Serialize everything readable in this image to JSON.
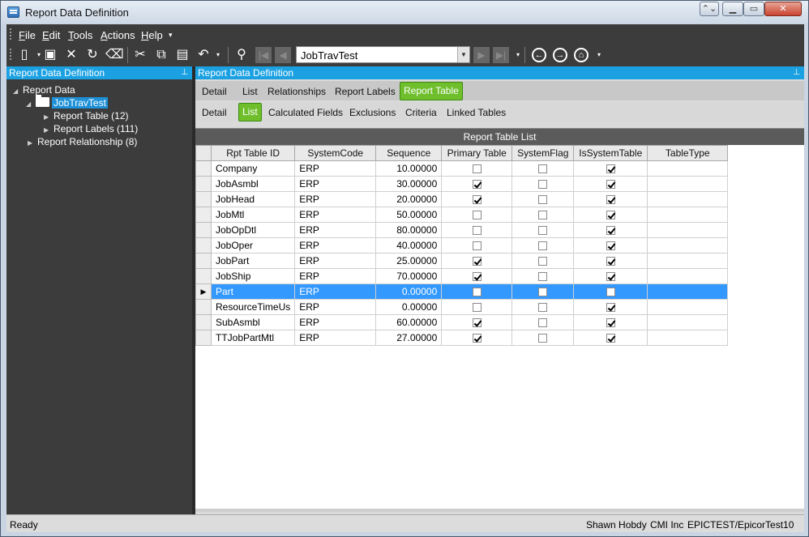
{
  "window": {
    "title": "Report Data Definition"
  },
  "menu": {
    "file": "File",
    "edit": "Edit",
    "tools": "Tools",
    "actions": "Actions",
    "help": "Help"
  },
  "toolbar": {
    "combo_value": "JobTravTest"
  },
  "left_panel": {
    "header": "Report Data Definition",
    "tree": {
      "root": "Report Data",
      "node": "JobTravTest",
      "child1": "Report Table (12)",
      "child2": "Report Labels (111)",
      "sibling": "Report Relationship (8)"
    }
  },
  "right_panel": {
    "header": "Report Data Definition",
    "tabs_top": [
      "Detail",
      "List",
      "Relationships",
      "Report Labels",
      "Report Table"
    ],
    "tabs_top_active": "Report Table",
    "tabs_sub": [
      "Detail",
      "List",
      "Calculated Fields",
      "Exclusions",
      "Criteria",
      "Linked Tables"
    ],
    "tabs_sub_active": "List",
    "grid": {
      "caption": "Report Table List",
      "columns": [
        "Rpt Table ID",
        "SystemCode",
        "Sequence",
        "Primary Table",
        "SystemFlag",
        "IsSystemTable",
        "TableType"
      ],
      "rows": [
        {
          "id": "Company",
          "code": "ERP",
          "seq": "10.00000",
          "primary": false,
          "sysflag": false,
          "issys": true,
          "type": ""
        },
        {
          "id": "JobAsmbl",
          "code": "ERP",
          "seq": "30.00000",
          "primary": true,
          "sysflag": false,
          "issys": true,
          "type": ""
        },
        {
          "id": "JobHead",
          "code": "ERP",
          "seq": "20.00000",
          "primary": true,
          "sysflag": false,
          "issys": true,
          "type": ""
        },
        {
          "id": "JobMtl",
          "code": "ERP",
          "seq": "50.00000",
          "primary": false,
          "sysflag": false,
          "issys": true,
          "type": ""
        },
        {
          "id": "JobOpDtl",
          "code": "ERP",
          "seq": "80.00000",
          "primary": false,
          "sysflag": false,
          "issys": true,
          "type": ""
        },
        {
          "id": "JobOper",
          "code": "ERP",
          "seq": "40.00000",
          "primary": false,
          "sysflag": false,
          "issys": true,
          "type": ""
        },
        {
          "id": "JobPart",
          "code": "ERP",
          "seq": "25.00000",
          "primary": true,
          "sysflag": false,
          "issys": true,
          "type": ""
        },
        {
          "id": "JobShip",
          "code": "ERP",
          "seq": "70.00000",
          "primary": true,
          "sysflag": false,
          "issys": true,
          "type": ""
        },
        {
          "id": "Part",
          "code": "ERP",
          "seq": "0.00000",
          "primary": false,
          "sysflag": false,
          "issys": false,
          "type": "",
          "selected": true
        },
        {
          "id": "ResourceTimeUs",
          "code": "ERP",
          "seq": "0.00000",
          "primary": false,
          "sysflag": false,
          "issys": true,
          "type": ""
        },
        {
          "id": "SubAsmbl",
          "code": "ERP",
          "seq": "60.00000",
          "primary": true,
          "sysflag": false,
          "issys": true,
          "type": ""
        },
        {
          "id": "TTJobPartMtl",
          "code": "ERP",
          "seq": "27.00000",
          "primary": true,
          "sysflag": false,
          "issys": true,
          "type": ""
        }
      ]
    }
  },
  "status": {
    "left": "Ready",
    "user": "Shawn Hobdy",
    "company": "CMI Inc",
    "environment": "EPICTEST/EpicorTest10"
  },
  "colors": {
    "accent_blue": "#1ba1e2",
    "active_tab_green": "#6fbf2d",
    "selection_blue": "#3399ff",
    "dark_bg": "#3c3c3c"
  },
  "icons": [
    "new-icon",
    "save-icon",
    "delete-icon",
    "refresh-icon",
    "clear-icon",
    "cut-icon",
    "copy-icon",
    "paste-icon",
    "undo-icon",
    "search-binoculars-icon",
    "first-record-icon",
    "previous-record-icon",
    "next-record-icon",
    "last-record-icon",
    "back-icon",
    "forward-icon",
    "home-icon"
  ]
}
